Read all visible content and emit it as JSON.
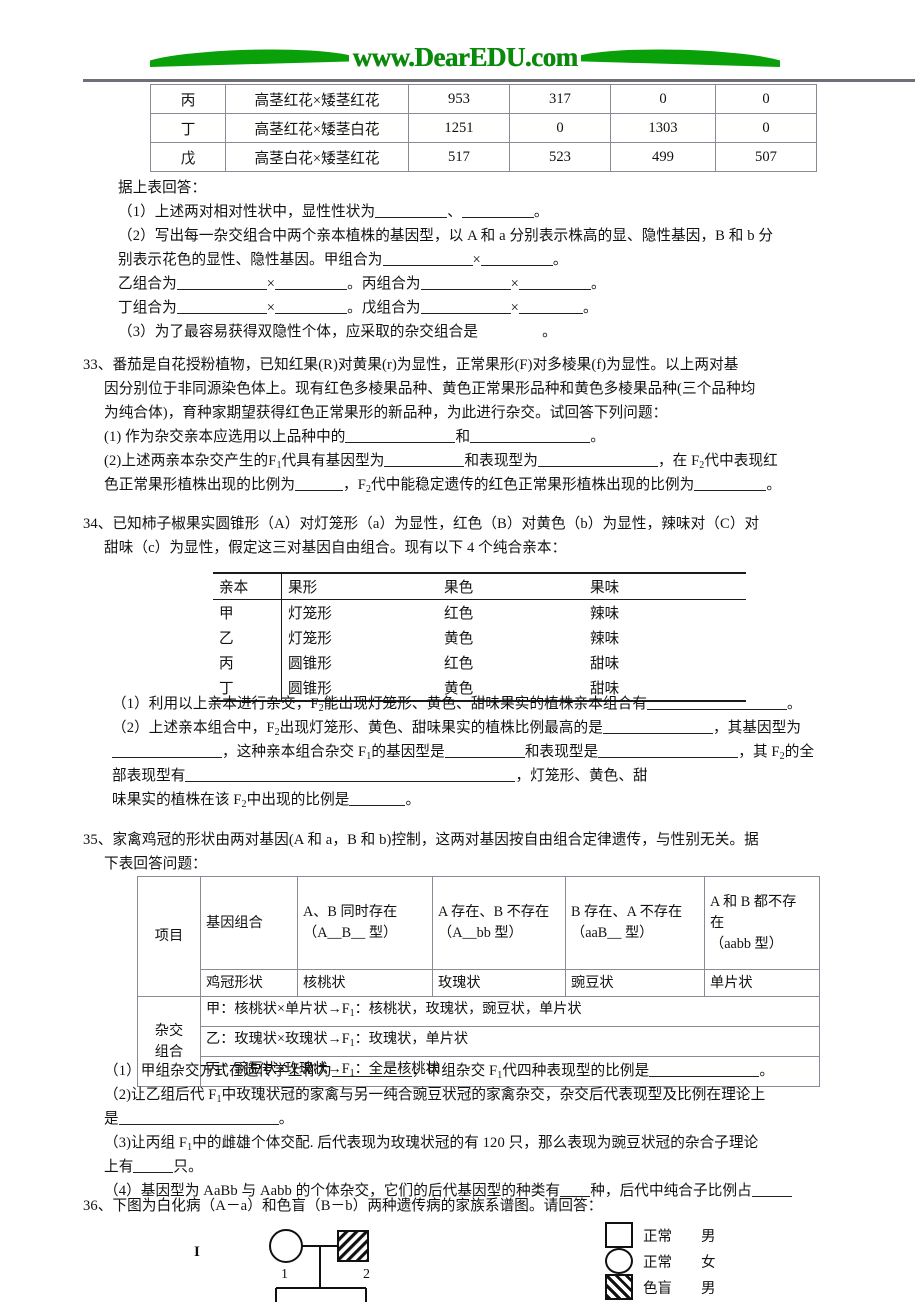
{
  "header": {
    "logo_text": "www.DearEDU.com",
    "logo_color": "#0a8a0a"
  },
  "table_top": {
    "rows": [
      {
        "label": "丙",
        "cross": "高茎红花×矮茎红花",
        "v1": "953",
        "v2": "317",
        "v3": "0",
        "v4": "0"
      },
      {
        "label": "丁",
        "cross": "高茎红花×矮茎白花",
        "v1": "1251",
        "v2": "0",
        "v3": "1303",
        "v4": "0"
      },
      {
        "label": "戊",
        "cross": "高茎白花×矮茎红花",
        "v1": "517",
        "v2": "523",
        "v3": "499",
        "v4": "507"
      }
    ]
  },
  "q32": {
    "lead": "据上表回答：",
    "l1a": "（1）上述两对相对性状中，显性性状为",
    "l1b": "、",
    "l1c": "。",
    "l2a": "（2）写出每一杂交组合中两个亲本植株的基因型，以 A 和 a 分别表示株高的显、隐性基因，B 和 b 分",
    "l3a": "别表示花色的显性、隐性基因。甲组合为",
    "l3b": "×",
    "l3c": "。",
    "l4a": "乙组合为",
    "l4b": "×",
    "l4c": "。丙组合为",
    "l4d": "×",
    "l4e": "。",
    "l5a": "丁组合为",
    "l5b": "×",
    "l5c": "。戊组合为",
    "l5d": "×",
    "l5e": "。",
    "l6a": "（3）为了最容易获得双隐性个体，应采取的杂交组合是",
    "l6b": "。"
  },
  "q33": {
    "l1": "33、番茄是自花授粉植物，已知红果(R)对黄果(r)为显性，正常果形(F)对多棱果(f)为显性。以上两对基",
    "l2": "因分别位于非同源染色体上。现有红色多棱果品种、黄色正常果形品种和黄色多棱果品种(三个品种均",
    "l3": "为纯合体)，育种家期望获得红色正常果形的新品种，为此进行杂交。试回答下列问题：",
    "l4a": "(1) 作为杂交亲本应选用以上品种中的",
    "l4b": "和",
    "l4c": "。",
    "l5a": "(2)上述两亲本杂交产生的F",
    "l5sub": "1",
    "l5b": "代具有基因型为",
    "l5c": "和表现型为",
    "l5d": "，在 F",
    "l5sub2": "2",
    "l5e": "代中表现红",
    "l6a": "色正常果形植株出现的比例为",
    "l6b": "，F",
    "l6sub": "2",
    "l6c": "代中能稳定遗传的红色正常果形植株出现的比例为",
    "l6d": "。"
  },
  "q34": {
    "l1": "34、已知柿子椒果实圆锥形（A）对灯笼形（a）为显性，红色（B）对黄色（b）为显性，辣味对（C）对",
    "l2": "甜味（c）为显性，假定这三对基因自由组合。现有以下 4 个纯合亲本：",
    "table": {
      "headers": [
        "亲本",
        "果形",
        "果色",
        "果味"
      ],
      "rows": [
        {
          "p": "甲",
          "shape": "灯笼形",
          "color": "红色",
          "taste": "辣味"
        },
        {
          "p": "乙",
          "shape": "灯笼形",
          "color": "黄色",
          "taste": "辣味"
        },
        {
          "p": "丙",
          "shape": "圆锥形",
          "color": "红色",
          "taste": "甜味"
        },
        {
          "p": "丁",
          "shape": "圆锥形",
          "color": "黄色",
          "taste": "甜味"
        }
      ]
    },
    "q1a": "（1）利用以上亲本进行杂交，F",
    "q1sub": "2",
    "q1b": "能出现灯笼形、黄色、甜味果实的植株亲本组合有",
    "q1c": "。",
    "q2a": "（2）上述亲本组合中，F",
    "q2sub": "2",
    "q2b": "出现灯笼形、黄色、甜味果实的植株比例最高的是",
    "q2c": "，其基因型为",
    "q3a": "，这种亲本组合杂交 F",
    "q3sub": "1",
    "q3b": "的基因型是",
    "q3c": "和表现型是",
    "q3d": "，其 F",
    "q3sub2": "2",
    "q3e": "的全",
    "q4a": "部表现型有",
    "q4b": "，灯笼形、黄色、甜",
    "q5a": "味果实的植株在该 F",
    "q5sub": "2",
    "q5b": "中出现的比例是",
    "q5c": "。"
  },
  "q35": {
    "l1": "35、家禽鸡冠的形状由两对基因(A 和 a，B 和 b)控制，这两对基因按自由组合定律遗传，与性别无关。据",
    "l2": "下表回答问题：",
    "table": {
      "corner": "项目",
      "h_gene": "基因组合",
      "h_col1_a": "A、B 同时存在",
      "h_col1_b": "（A__B__ 型）",
      "h_col2_a": "A 存在、B 不存在",
      "h_col2_b": "（A__bb 型）",
      "h_col3_a": "B 存在、A 不存在",
      "h_col3_b": "（aaB__ 型）",
      "h_col4_a": "A 和 B 都不存",
      "h_col4_b": "在",
      "h_col4_c": "（aabb 型）",
      "r_shape": "鸡冠形状",
      "shapes": [
        "核桃状",
        "玫瑰状",
        "豌豆状",
        "单片状"
      ],
      "cross_label_1": "杂交",
      "cross_label_2": "组合",
      "crosses": [
        {
          "pre": "甲：核桃状×单片状→F",
          "sub": "1",
          "post": "：核桃状，玫瑰状，豌豆状，单片状"
        },
        {
          "pre": "乙：玫瑰状×玫瑰状→F",
          "sub": "1",
          "post": "：玫瑰状，单片状"
        },
        {
          "pre": "丙：豌豆状×玫瑰状→F",
          "sub": "1",
          "post": "：全是核桃状"
        }
      ]
    },
    "q1a": "（1）甲组杂交方式在遗传学上称为",
    "q1b": "，甲组杂交 F",
    "q1sub": "1",
    "q1c": "代四种表现型的比例是",
    "q1d": "。",
    "q2a": "（2)让乙组后代 F",
    "q2sub": "1",
    "q2b": "中玫瑰状冠的家禽与另一纯合豌豆状冠的家禽杂交，杂交后代表现型及比例在理论上",
    "q2c": "是",
    "q2d": "。",
    "q3a": "（3)让丙组 F",
    "q3sub": "1",
    "q3b": "中的雌雄个体交配. 后代表现为玫瑰状冠的有 120 只，那么表现为豌豆状冠的杂合子理论",
    "q3c": "上有",
    "q3d": "只。",
    "q4a": "（4）基因型为 AaBb 与 Aabb 的个体杂交，它们的后代基因型的种类有",
    "q4b": "种，后代中纯合子比例占"
  },
  "q36": {
    "l1": "36、下图为白化病（A－a）和色盲（B－b）两种遗传病的家族系谱图。请回答：",
    "pedigree": {
      "generation": "I",
      "id1": "1",
      "id2": "2"
    },
    "legend": [
      {
        "icon": "square",
        "label": "正常",
        "sex": "男"
      },
      {
        "icon": "circle",
        "label": "正常",
        "sex": "女"
      },
      {
        "icon": "hatched-square",
        "label": "色盲",
        "sex": "男"
      }
    ]
  }
}
